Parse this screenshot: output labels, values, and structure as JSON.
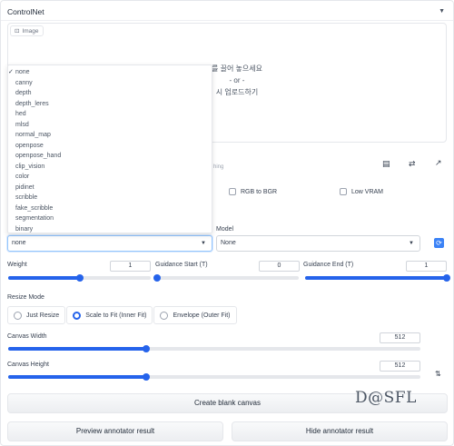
{
  "header": {
    "title": "ControlNet",
    "collapse_icon": "triangle-down-icon"
  },
  "image_panel": {
    "label": "Image",
    "drop_line1": "를 끌어 놓으세요",
    "drop_line2": "- or -",
    "drop_line3": "시 업로드하기"
  },
  "hidden_label": "hing",
  "checkboxes": {
    "rgb_to_bgr": "RGB to BGR",
    "low_vram": "Low VRAM"
  },
  "preprocessor_options": [
    "none",
    "canny",
    "depth",
    "depth_leres",
    "hed",
    "mlsd",
    "normal_map",
    "openpose",
    "openpose_hand",
    "clip_vision",
    "color",
    "pidinet",
    "scribble",
    "fake_scribble",
    "segmentation",
    "binary"
  ],
  "preprocessor": {
    "value": "none",
    "selected_mark": "✓"
  },
  "model": {
    "label": "Model",
    "value": "None"
  },
  "sliders": {
    "weight": {
      "label": "Weight",
      "value": "1",
      "fraction": 0.5
    },
    "guidance_start": {
      "label": "Guidance Start (T)",
      "value": "0",
      "fraction": 0.0
    },
    "guidance_end": {
      "label": "Guidance End (T)",
      "value": "1",
      "fraction": 1.0
    },
    "canvas_width": {
      "label": "Canvas Width",
      "value": "512",
      "fraction": 0.335
    },
    "canvas_height": {
      "label": "Canvas Height",
      "value": "512",
      "fraction": 0.335
    }
  },
  "resize_mode": {
    "label": "Resize Mode",
    "options": [
      "Just Resize",
      "Scale to Fit (Inner Fit)",
      "Envelope (Outer Fit)"
    ],
    "selected": "Scale to Fit (Inner Fit)"
  },
  "buttons": {
    "create_canvas": "Create blank canvas",
    "preview": "Preview annotator result",
    "hide": "Hide annotator result"
  },
  "watermark": "D@SFL",
  "colors": {
    "accent": "#2563eb",
    "track": "#e5e7eb"
  }
}
